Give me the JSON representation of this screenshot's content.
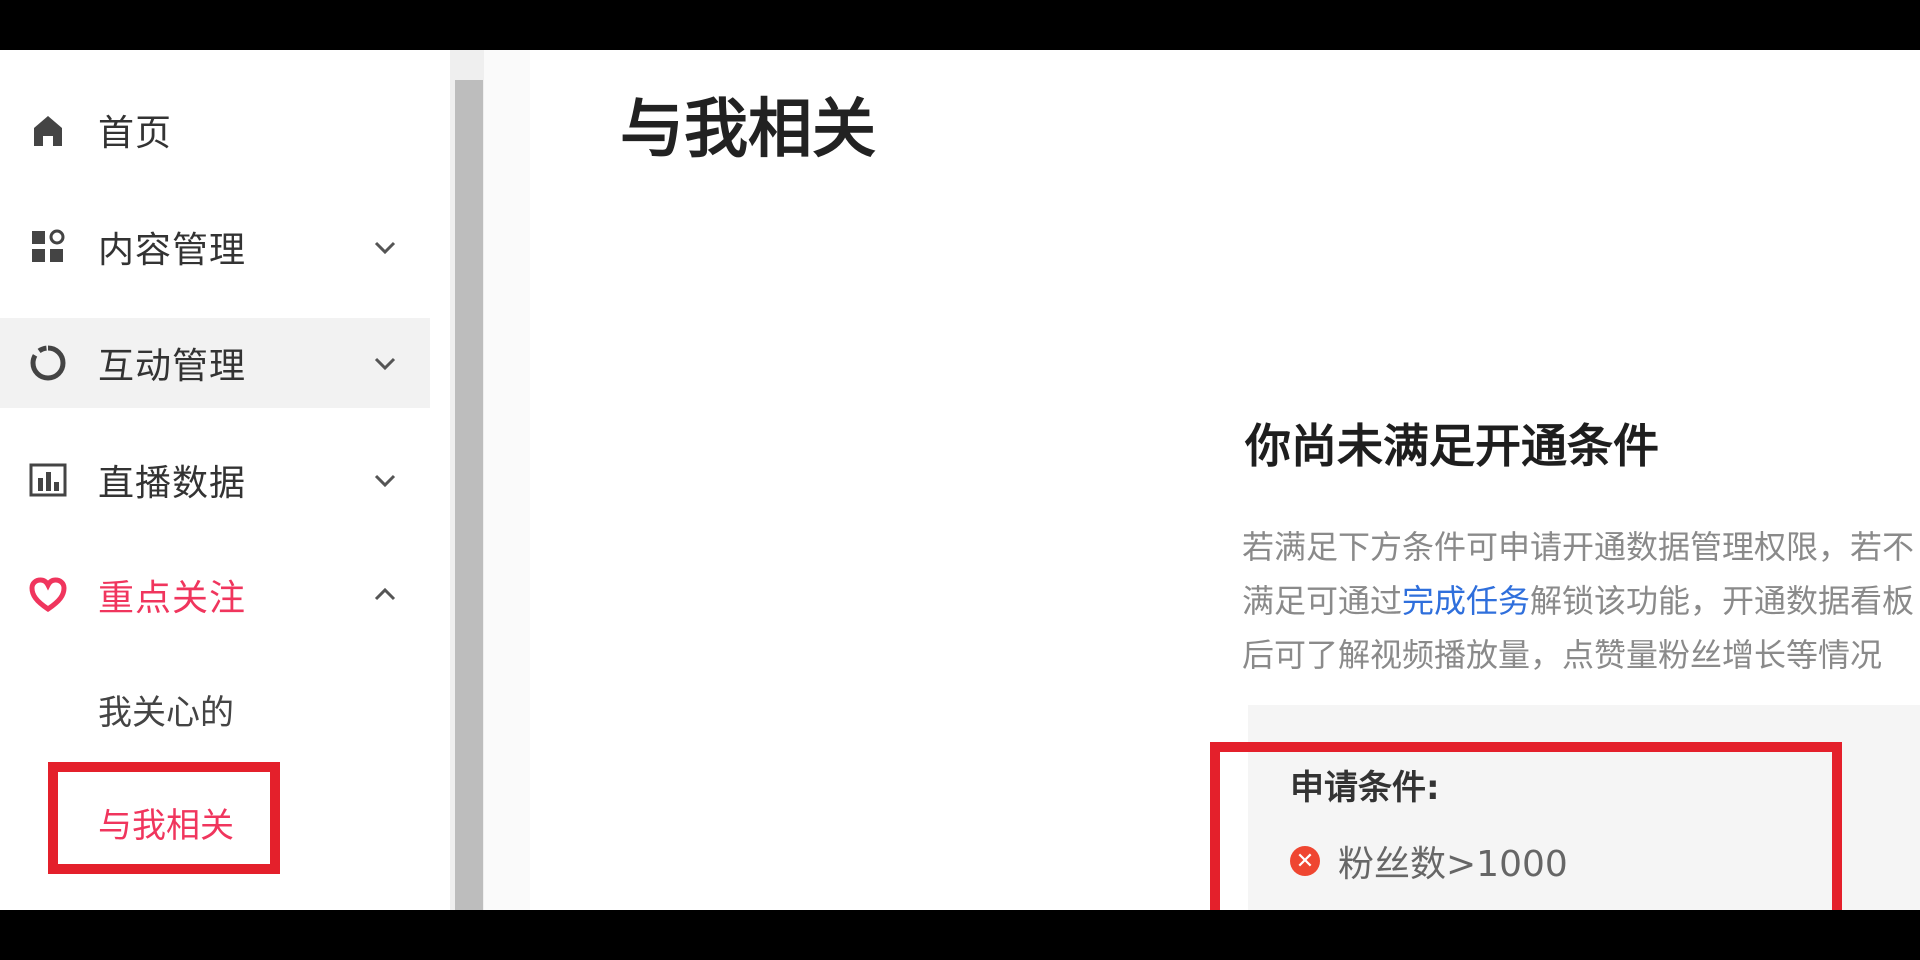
{
  "sidebar": {
    "items": [
      {
        "label": "首页",
        "icon": "home-icon"
      },
      {
        "label": "内容管理",
        "icon": "content-grid-icon",
        "chevron": "down"
      },
      {
        "label": "互动管理",
        "icon": "interaction-icon",
        "chevron": "down"
      },
      {
        "label": "直播数据",
        "icon": "bar-chart-icon",
        "chevron": "down"
      },
      {
        "label": "重点关注",
        "icon": "heart-icon",
        "chevron": "up"
      }
    ],
    "sub_items": [
      {
        "label": "我关心的"
      },
      {
        "label": "与我相关"
      }
    ]
  },
  "main": {
    "title": "与我相关",
    "notice": {
      "heading": "你尚未满足开通条件",
      "desc_part1": "若满足下方条件可申请开通数据管理权限，若不满足可通过",
      "desc_link": "完成任务",
      "desc_part2": "解锁该功能，开通数据看板后可了解视频播放量，点赞量粉丝增长等情况"
    },
    "conditions": {
      "label": "申请条件:",
      "items": [
        {
          "text": "粉丝数>1000",
          "status": "unmet"
        }
      ]
    }
  },
  "colors": {
    "accent": "#f0355d",
    "highlight_box": "#e4202b",
    "link": "#2f6fdc"
  }
}
